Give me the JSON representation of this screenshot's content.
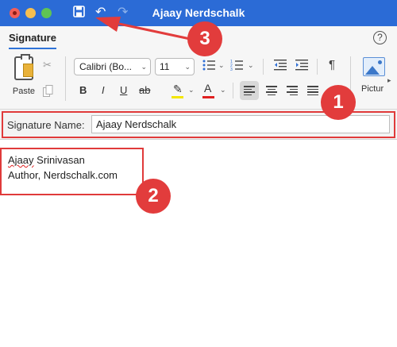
{
  "window": {
    "title": "Ajaay Nerdschalk",
    "save_icon": "💾",
    "undo_icon": "↶",
    "redo_icon": "↷"
  },
  "ribbon": {
    "tab_label": "Signature",
    "help_icon": "?",
    "paste_label": "Paste",
    "cut_icon": "✂",
    "copy_icon": "⎘",
    "font_name": "Calibri (Bo...",
    "font_size": "11",
    "dropdown_caret": "⌄",
    "bullets_icon": "☰",
    "numbering_icon": "☰",
    "outdent_icon": "⇤",
    "indent_icon": "⇥",
    "pilcrow_icon": "¶",
    "bold_label": "B",
    "italic_label": "I",
    "underline_label": "U",
    "strike_label": "ab",
    "highlight_icon": "✎",
    "font_color_label": "A",
    "highlight_color": "#f3e600",
    "font_color": "#e02020",
    "picture_label": "Pictur",
    "more_icon": "▸"
  },
  "signature": {
    "name_label": "Signature Name:",
    "name_value": "Ajaay Nerdschalk",
    "body_first_word": "Ajaay",
    "body_line1_rest": " Srinivasan",
    "body_line2": "Author, Nerdschalk.com"
  },
  "annotations": {
    "one": "1",
    "two": "2",
    "three": "3",
    "color": "#e23c3c"
  }
}
